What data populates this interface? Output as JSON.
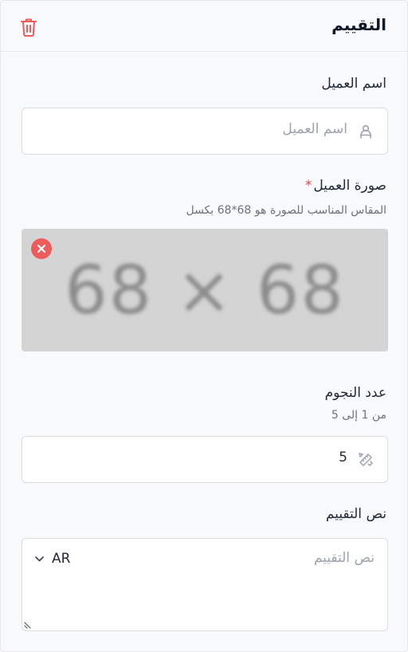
{
  "header": {
    "title": "التقييم",
    "delete_icon": "trash-icon"
  },
  "customer_name": {
    "label": "اسم العميل",
    "placeholder": "اسم العميل",
    "value": "",
    "icon": "user-icon"
  },
  "customer_image": {
    "label": "صورة العميل",
    "required_mark": "*",
    "hint": "المقاس المناسب للصورة هو 68*68 بكسل",
    "preview_text": "68 × 68",
    "remove_icon": "close-circle-icon"
  },
  "stars": {
    "label": "عدد النجوم",
    "hint": "من 1 إلى 5",
    "value": "5",
    "icon": "ruler-pencil-icon"
  },
  "review_text": {
    "label": "نص التقييم",
    "placeholder": "نص التقييم",
    "language": "AR",
    "language_icon": "chevron-down-icon"
  },
  "colors": {
    "danger": "#ef4444",
    "border": "#d9dce1",
    "background": "#f8f9fb"
  }
}
